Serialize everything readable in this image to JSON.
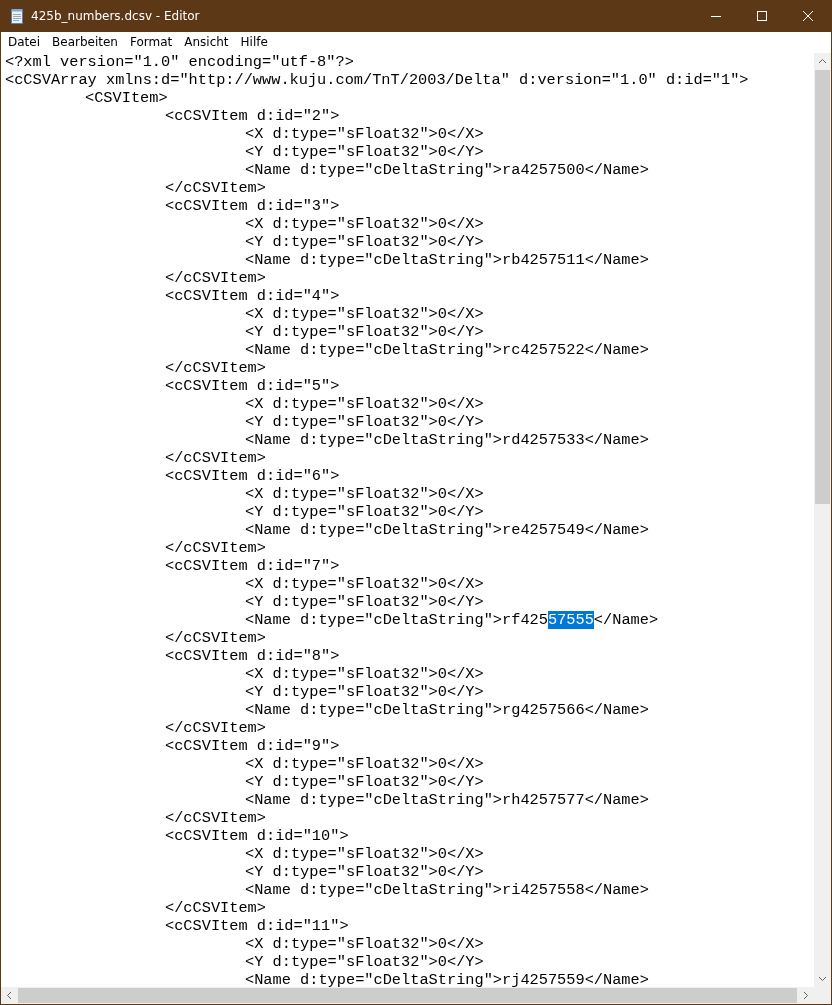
{
  "window": {
    "title": "425b_numbers.dcsv - Editor"
  },
  "menu": [
    "Datei",
    "Bearbeiten",
    "Format",
    "Ansicht",
    "Hilfe"
  ],
  "lines": [
    {
      "parts": [
        {
          "text": "<?xml version=\"1.0\" encoding=\"utf-8\"?>",
          "selected": false
        }
      ]
    },
    {
      "parts": [
        {
          "text": "<cCSVArray xmlns:d=\"http://www.kuju.com/TnT/2003/Delta\" d:version=\"1.0\" d:id=\"1\">",
          "selected": false
        }
      ]
    },
    {
      "parts": [
        {
          "text": "\t<CSVItem>",
          "selected": false
        }
      ]
    },
    {
      "parts": [
        {
          "text": "\t\t<cCSVItem d:id=\"2\">",
          "selected": false
        }
      ]
    },
    {
      "parts": [
        {
          "text": "\t\t\t<X d:type=\"sFloat32\">0</X>",
          "selected": false
        }
      ]
    },
    {
      "parts": [
        {
          "text": "\t\t\t<Y d:type=\"sFloat32\">0</Y>",
          "selected": false
        }
      ]
    },
    {
      "parts": [
        {
          "text": "\t\t\t<Name d:type=\"cDeltaString\">ra4257500</Name>",
          "selected": false
        }
      ]
    },
    {
      "parts": [
        {
          "text": "\t\t</cCSVItem>",
          "selected": false
        }
      ]
    },
    {
      "parts": [
        {
          "text": "\t\t<cCSVItem d:id=\"3\">",
          "selected": false
        }
      ]
    },
    {
      "parts": [
        {
          "text": "\t\t\t<X d:type=\"sFloat32\">0</X>",
          "selected": false
        }
      ]
    },
    {
      "parts": [
        {
          "text": "\t\t\t<Y d:type=\"sFloat32\">0</Y>",
          "selected": false
        }
      ]
    },
    {
      "parts": [
        {
          "text": "\t\t\t<Name d:type=\"cDeltaString\">rb4257511</Name>",
          "selected": false
        }
      ]
    },
    {
      "parts": [
        {
          "text": "\t\t</cCSVItem>",
          "selected": false
        }
      ]
    },
    {
      "parts": [
        {
          "text": "\t\t<cCSVItem d:id=\"4\">",
          "selected": false
        }
      ]
    },
    {
      "parts": [
        {
          "text": "\t\t\t<X d:type=\"sFloat32\">0</X>",
          "selected": false
        }
      ]
    },
    {
      "parts": [
        {
          "text": "\t\t\t<Y d:type=\"sFloat32\">0</Y>",
          "selected": false
        }
      ]
    },
    {
      "parts": [
        {
          "text": "\t\t\t<Name d:type=\"cDeltaString\">rc4257522</Name>",
          "selected": false
        }
      ]
    },
    {
      "parts": [
        {
          "text": "\t\t</cCSVItem>",
          "selected": false
        }
      ]
    },
    {
      "parts": [
        {
          "text": "\t\t<cCSVItem d:id=\"5\">",
          "selected": false
        }
      ]
    },
    {
      "parts": [
        {
          "text": "\t\t\t<X d:type=\"sFloat32\">0</X>",
          "selected": false
        }
      ]
    },
    {
      "parts": [
        {
          "text": "\t\t\t<Y d:type=\"sFloat32\">0</Y>",
          "selected": false
        }
      ]
    },
    {
      "parts": [
        {
          "text": "\t\t\t<Name d:type=\"cDeltaString\">rd4257533</Name>",
          "selected": false
        }
      ]
    },
    {
      "parts": [
        {
          "text": "\t\t</cCSVItem>",
          "selected": false
        }
      ]
    },
    {
      "parts": [
        {
          "text": "\t\t<cCSVItem d:id=\"6\">",
          "selected": false
        }
      ]
    },
    {
      "parts": [
        {
          "text": "\t\t\t<X d:type=\"sFloat32\">0</X>",
          "selected": false
        }
      ]
    },
    {
      "parts": [
        {
          "text": "\t\t\t<Y d:type=\"sFloat32\">0</Y>",
          "selected": false
        }
      ]
    },
    {
      "parts": [
        {
          "text": "\t\t\t<Name d:type=\"cDeltaString\">re4257549</Name>",
          "selected": false
        }
      ]
    },
    {
      "parts": [
        {
          "text": "\t\t</cCSVItem>",
          "selected": false
        }
      ]
    },
    {
      "parts": [
        {
          "text": "\t\t<cCSVItem d:id=\"7\">",
          "selected": false
        }
      ]
    },
    {
      "parts": [
        {
          "text": "\t\t\t<X d:type=\"sFloat32\">0</X>",
          "selected": false
        }
      ]
    },
    {
      "parts": [
        {
          "text": "\t\t\t<Y d:type=\"sFloat32\">0</Y>",
          "selected": false
        }
      ]
    },
    {
      "parts": [
        {
          "text": "\t\t\t<Name d:type=\"cDeltaString\">rf425",
          "selected": false
        },
        {
          "text": "57555",
          "selected": true
        },
        {
          "text": "</Name>",
          "selected": false
        }
      ]
    },
    {
      "parts": [
        {
          "text": "\t\t</cCSVItem>",
          "selected": false
        }
      ]
    },
    {
      "parts": [
        {
          "text": "\t\t<cCSVItem d:id=\"8\">",
          "selected": false
        }
      ]
    },
    {
      "parts": [
        {
          "text": "\t\t\t<X d:type=\"sFloat32\">0</X>",
          "selected": false
        }
      ]
    },
    {
      "parts": [
        {
          "text": "\t\t\t<Y d:type=\"sFloat32\">0</Y>",
          "selected": false
        }
      ]
    },
    {
      "parts": [
        {
          "text": "\t\t\t<Name d:type=\"cDeltaString\">rg4257566</Name>",
          "selected": false
        }
      ]
    },
    {
      "parts": [
        {
          "text": "\t\t</cCSVItem>",
          "selected": false
        }
      ]
    },
    {
      "parts": [
        {
          "text": "\t\t<cCSVItem d:id=\"9\">",
          "selected": false
        }
      ]
    },
    {
      "parts": [
        {
          "text": "\t\t\t<X d:type=\"sFloat32\">0</X>",
          "selected": false
        }
      ]
    },
    {
      "parts": [
        {
          "text": "\t\t\t<Y d:type=\"sFloat32\">0</Y>",
          "selected": false
        }
      ]
    },
    {
      "parts": [
        {
          "text": "\t\t\t<Name d:type=\"cDeltaString\">rh4257577</Name>",
          "selected": false
        }
      ]
    },
    {
      "parts": [
        {
          "text": "\t\t</cCSVItem>",
          "selected": false
        }
      ]
    },
    {
      "parts": [
        {
          "text": "\t\t<cCSVItem d:id=\"10\">",
          "selected": false
        }
      ]
    },
    {
      "parts": [
        {
          "text": "\t\t\t<X d:type=\"sFloat32\">0</X>",
          "selected": false
        }
      ]
    },
    {
      "parts": [
        {
          "text": "\t\t\t<Y d:type=\"sFloat32\">0</Y>",
          "selected": false
        }
      ]
    },
    {
      "parts": [
        {
          "text": "\t\t\t<Name d:type=\"cDeltaString\">ri4257558</Name>",
          "selected": false
        }
      ]
    },
    {
      "parts": [
        {
          "text": "\t\t</cCSVItem>",
          "selected": false
        }
      ]
    },
    {
      "parts": [
        {
          "text": "\t\t<cCSVItem d:id=\"11\">",
          "selected": false
        }
      ]
    },
    {
      "parts": [
        {
          "text": "\t\t\t<X d:type=\"sFloat32\">0</X>",
          "selected": false
        }
      ]
    },
    {
      "parts": [
        {
          "text": "\t\t\t<Y d:type=\"sFloat32\">0</Y>",
          "selected": false
        }
      ]
    },
    {
      "parts": [
        {
          "text": "\t\t\t<Name d:type=\"cDeltaString\">rj4257559</Name>",
          "selected": false
        }
      ]
    }
  ]
}
